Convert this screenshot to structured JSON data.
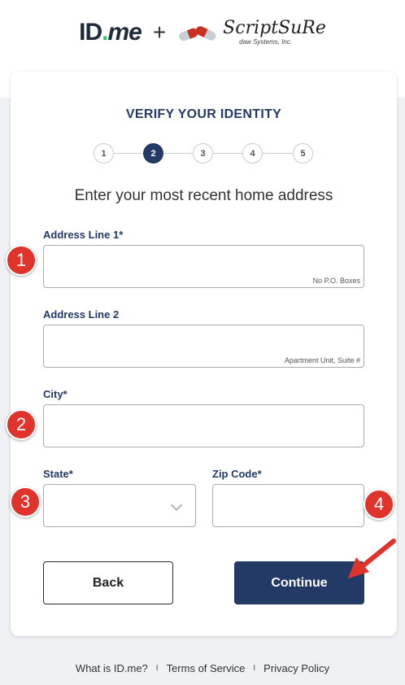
{
  "header": {
    "idme_logo": "ID.me",
    "plus": "+",
    "partner_name": "ScriptSuRe",
    "partner_sub": "daw Systems, Inc."
  },
  "card": {
    "title": "VERIFY YOUR IDENTITY",
    "steps": [
      "1",
      "2",
      "3",
      "4",
      "5"
    ],
    "active_step": 2,
    "subtitle": "Enter your most recent home address"
  },
  "form": {
    "address1_label": "Address Line 1*",
    "address1_hint": "No P.O. Boxes",
    "address1_value": "",
    "address2_label": "Address Line 2",
    "address2_hint": "Apartment Unit, Suite #",
    "address2_value": "",
    "city_label": "City*",
    "city_value": "",
    "state_label": "State*",
    "state_value": "",
    "zip_label": "Zip Code*",
    "zip_value": ""
  },
  "buttons": {
    "back": "Back",
    "continue": "Continue"
  },
  "annotations": [
    "1",
    "2",
    "3",
    "4"
  ],
  "footer": {
    "links": [
      "What is ID.me?",
      "Terms of Service",
      "Privacy Policy"
    ],
    "separator": "I"
  },
  "colors": {
    "primary": "#233a66",
    "marker": "#e0332c",
    "idme_dot": "#2fbf71"
  }
}
